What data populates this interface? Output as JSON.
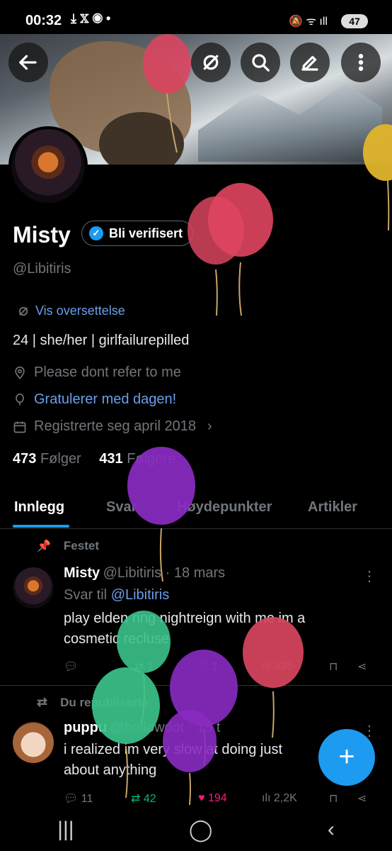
{
  "status_bar": {
    "time": "00:32",
    "battery": "47"
  },
  "profile": {
    "name": "Misty",
    "verify_label": "Bli verifisert",
    "handle": "@Libitiris",
    "translate_label": "Vis oversettelse",
    "bio": "24 | she/her | girlfailurepilled",
    "location": "Please dont refer to me",
    "birthday": "Gratulerer med dagen!",
    "joined": "Registrerte seg april 2018",
    "following_count": "473",
    "following_label": "Følger",
    "followers_count": "431",
    "followers_label": "Følgere"
  },
  "tabs": [
    "Innlegg",
    "Svar",
    "Høydepunkter",
    "Artikler"
  ],
  "posts": [
    {
      "context": "Festet",
      "author": "Misty",
      "handle_time": "@Libitiris · 18 mars",
      "reply_prefix": "Svar til ",
      "reply_to": "@Libitiris",
      "text": "play elden ring nightreign with me im a cosmetic recluse",
      "replies": "",
      "reposts": "1",
      "likes": "1",
      "views": "335"
    },
    {
      "context": "Du republiserte",
      "author": "puppu",
      "handle_time": "@hollowdot · 15 t",
      "text": "i realized im very slow at doing just about anything",
      "replies": "11",
      "reposts": "42",
      "likes": "194",
      "views": "2,2K"
    }
  ],
  "colors": {
    "accent": "#1d9bf0",
    "link": "#6a9fea",
    "like": "#f91880",
    "repost": "#00ba7c"
  }
}
